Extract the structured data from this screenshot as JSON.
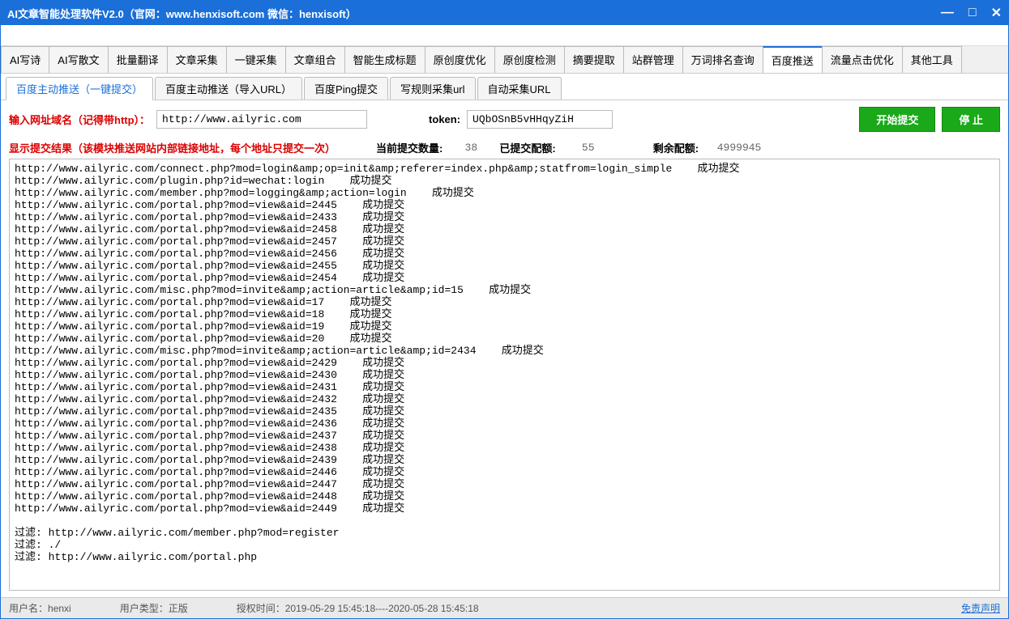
{
  "titlebar": {
    "text": "AI文章智能处理软件V2.0（官网：www.henxisoft.com  微信：henxisoft）"
  },
  "main_tabs": [
    "AI写诗",
    "AI写散文",
    "批量翻译",
    "文章采集",
    "一键采集",
    "文章组合",
    "智能生成标题",
    "原创度优化",
    "原创度检测",
    "摘要提取",
    "站群管理",
    "万词排名查询",
    "百度推送",
    "流量点击优化",
    "其他工具"
  ],
  "main_tab_active": 12,
  "sub_tabs": [
    "百度主动推送（一键提交）",
    "百度主动推送（导入URL）",
    "百度Ping提交",
    "写规则采集url",
    "自动采集URL"
  ],
  "sub_tab_active": 0,
  "input": {
    "domain_label": "输入网址域名（记得带http）：",
    "domain_value": "http://www.ailyric.com",
    "token_label": "token:",
    "token_value": "UQbOSnB5vHHqyZiH",
    "start_btn": "开始提交",
    "stop_btn": "停  止"
  },
  "stats": {
    "result_label": "显示提交结果（该模块推送网站内部链接地址，每个地址只提交一次）",
    "current_label": "当前提交数量:",
    "current_value": "38",
    "submitted_label": "已提交配额:",
    "submitted_value": "55",
    "remain_label": "剩余配额:",
    "remain_value": "4999945"
  },
  "log_lines": [
    "http://www.ailyric.com/connect.php?mod=login&amp;op=init&amp;referer=index.php&amp;statfrom=login_simple    成功提交",
    "http://www.ailyric.com/plugin.php?id=wechat:login    成功提交",
    "http://www.ailyric.com/member.php?mod=logging&amp;action=login    成功提交",
    "http://www.ailyric.com/portal.php?mod=view&aid=2445    成功提交",
    "http://www.ailyric.com/portal.php?mod=view&aid=2433    成功提交",
    "http://www.ailyric.com/portal.php?mod=view&aid=2458    成功提交",
    "http://www.ailyric.com/portal.php?mod=view&aid=2457    成功提交",
    "http://www.ailyric.com/portal.php?mod=view&aid=2456    成功提交",
    "http://www.ailyric.com/portal.php?mod=view&aid=2455    成功提交",
    "http://www.ailyric.com/portal.php?mod=view&aid=2454    成功提交",
    "http://www.ailyric.com/misc.php?mod=invite&amp;action=article&amp;id=15    成功提交",
    "http://www.ailyric.com/portal.php?mod=view&aid=17    成功提交",
    "http://www.ailyric.com/portal.php?mod=view&aid=18    成功提交",
    "http://www.ailyric.com/portal.php?mod=view&aid=19    成功提交",
    "http://www.ailyric.com/portal.php?mod=view&aid=20    成功提交",
    "http://www.ailyric.com/misc.php?mod=invite&amp;action=article&amp;id=2434    成功提交",
    "http://www.ailyric.com/portal.php?mod=view&aid=2429    成功提交",
    "http://www.ailyric.com/portal.php?mod=view&aid=2430    成功提交",
    "http://www.ailyric.com/portal.php?mod=view&aid=2431    成功提交",
    "http://www.ailyric.com/portal.php?mod=view&aid=2432    成功提交",
    "http://www.ailyric.com/portal.php?mod=view&aid=2435    成功提交",
    "http://www.ailyric.com/portal.php?mod=view&aid=2436    成功提交",
    "http://www.ailyric.com/portal.php?mod=view&aid=2437    成功提交",
    "http://www.ailyric.com/portal.php?mod=view&aid=2438    成功提交",
    "http://www.ailyric.com/portal.php?mod=view&aid=2439    成功提交",
    "http://www.ailyric.com/portal.php?mod=view&aid=2446    成功提交",
    "http://www.ailyric.com/portal.php?mod=view&aid=2447    成功提交",
    "http://www.ailyric.com/portal.php?mod=view&aid=2448    成功提交",
    "http://www.ailyric.com/portal.php?mod=view&aid=2449    成功提交",
    "",
    "过滤: http://www.ailyric.com/member.php?mod=register",
    "过滤: ./",
    "过滤: http://www.ailyric.com/portal.php"
  ],
  "status": {
    "user_label": "用户名：",
    "user_value": "henxi",
    "type_label": "用户类型：",
    "type_value": "正版",
    "auth_label": "授权时间：",
    "auth_value": "2019-05-29 15:45:18----2020-05-28 15:45:18",
    "disclaimer": "免责声明"
  }
}
